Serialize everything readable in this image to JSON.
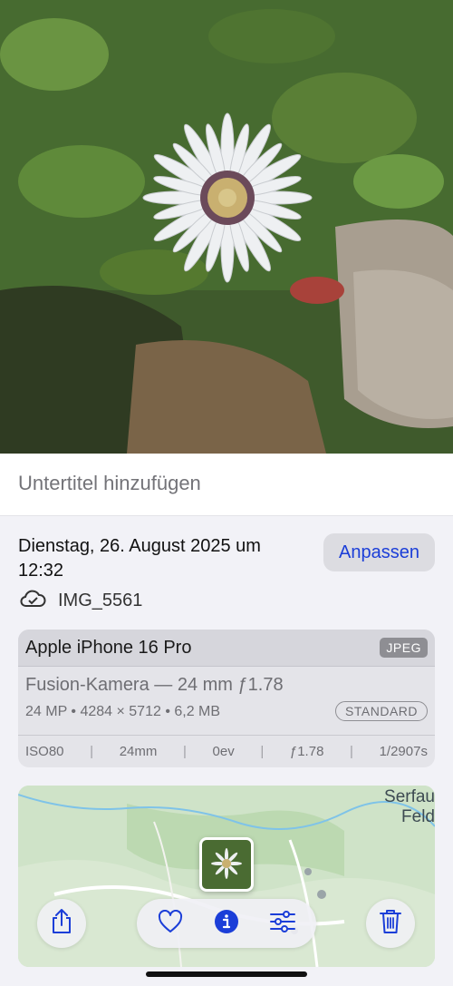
{
  "caption": {
    "placeholder": "Untertitel hinzufügen"
  },
  "info": {
    "date_line1": "Dienstag, 26. August 2025 um",
    "date_line2": "12:32",
    "adjust_label": "Anpassen",
    "file_name": "IMG_5561"
  },
  "camera": {
    "model": "Apple iPhone 16 Pro",
    "format": "JPEG",
    "lens": "Fusion-Kamera — 24 mm ƒ1.78",
    "specs": "24 MP • 4284 × 5712 • 6,2 MB",
    "mode": "STANDARD",
    "exif": [
      "ISO80",
      "24mm",
      "0ev",
      "ƒ1.78",
      "1/2907s"
    ]
  },
  "map": {
    "place_line1": "Serfau",
    "place_line2": "Feld"
  },
  "toolbar": {
    "icons": [
      "share-icon",
      "heart-icon",
      "info-icon",
      "adjust-icon",
      "trash-icon"
    ]
  },
  "colors": {
    "accent": "#1b3ed8",
    "background": "#f2f2f7"
  }
}
